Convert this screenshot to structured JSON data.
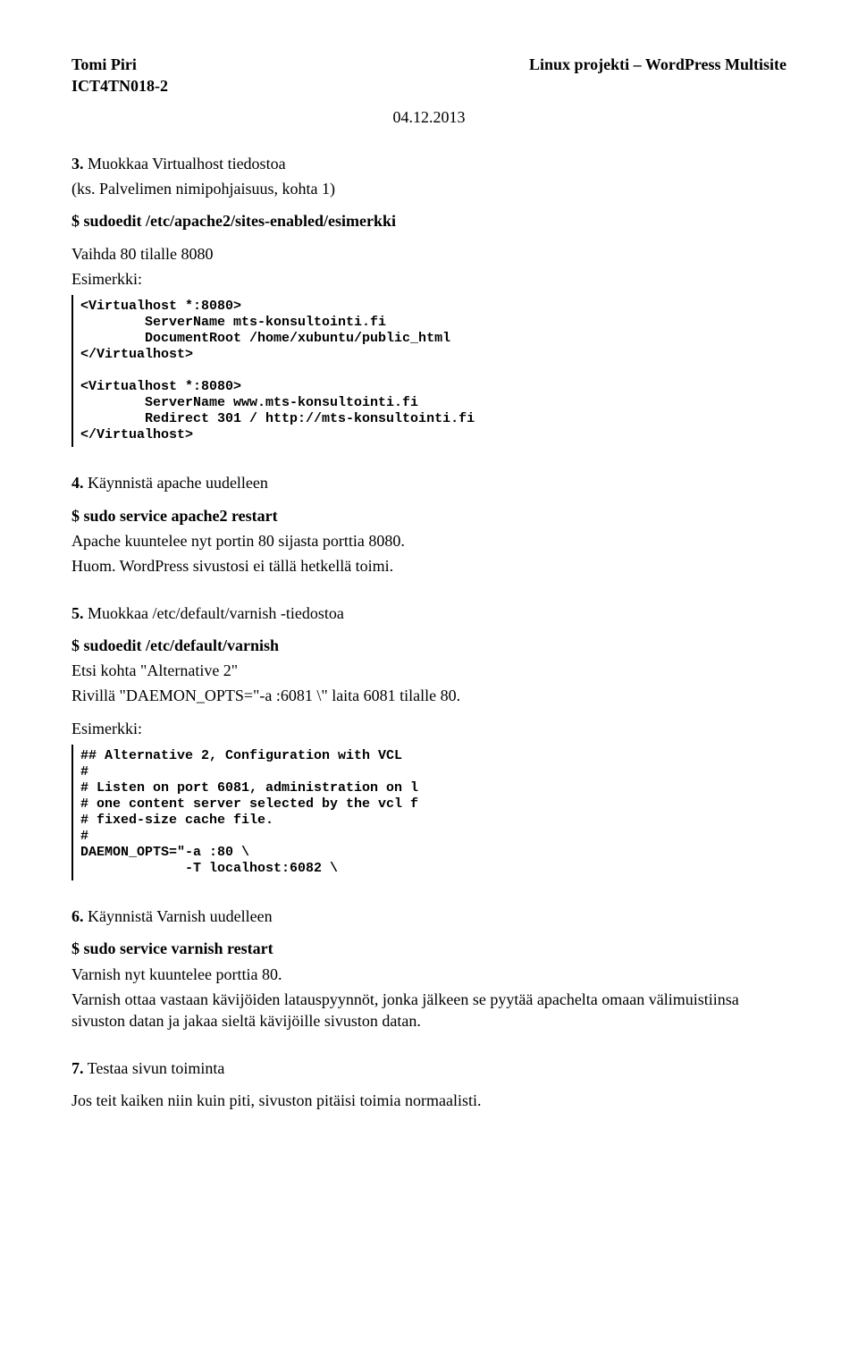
{
  "header": {
    "author": "Tomi Piri",
    "course": "ICT4TN018-2",
    "title": "Linux projekti – WordPress Multisite",
    "date": "04.12.2013"
  },
  "s3": {
    "heading": "3.",
    "title": " Muokkaa Virtualhost tiedostoa",
    "line2": "(ks. Palvelimen nimipohjaisuus, kohta 1)",
    "cmd": "$ sudoedit /etc/apache2/sites-enabled/esimerkki",
    "desc1": "Vaihda 80 tilalle 8080",
    "desc2": "Esimerkki:",
    "code": "<Virtualhost *:8080>\n        ServerName mts-konsultointi.fi\n        DocumentRoot /home/xubuntu/public_html\n</Virtualhost>\n\n<Virtualhost *:8080>\n        ServerName www.mts-konsultointi.fi\n        Redirect 301 / http://mts-konsultointi.fi\n</Virtualhost>",
    "codeunder": "_"
  },
  "s4": {
    "heading": "4.",
    "title": " Käynnistä apache uudelleen",
    "cmd": "$ sudo service apache2 restart",
    "desc1": "Apache kuuntelee nyt portin 80 sijasta porttia 8080.",
    "desc2": "Huom. WordPress sivustosi ei tällä hetkellä toimi."
  },
  "s5": {
    "heading": "5.",
    "title": " Muokkaa /etc/default/varnish -tiedostoa",
    "cmd": "$ sudoedit /etc/default/varnish",
    "desc1": "Etsi kohta \"Alternative 2\"",
    "desc2": "Rivillä \"DAEMON_OPTS=\"-a :6081 \\\" laita 6081 tilalle 80.",
    "desc3": "Esimerkki:",
    "code": "## Alternative 2, Configuration with VCL\n#\n# Listen on port 6081, administration on l\n# one content server selected by the vcl f\n# fixed-size cache file.\n#\nDAEMON_OPTS=\"-a :80 \\\n             -T localhost:6082 \\"
  },
  "s6": {
    "heading": "6.",
    "title": " Käynnistä Varnish uudelleen",
    "cmd": "$ sudo service varnish restart",
    "desc1": "Varnish nyt kuuntelee porttia 80.",
    "desc2": "Varnish ottaa vastaan kävijöiden latauspyynnöt, jonka jälkeen se pyytää apachelta omaan välimuistiinsa sivuston datan ja jakaa sieltä kävijöille sivuston datan."
  },
  "s7": {
    "heading": "7.",
    "title": " Testaa sivun toiminta",
    "desc1": "Jos teit kaiken niin kuin piti, sivuston pitäisi toimia normaalisti."
  }
}
